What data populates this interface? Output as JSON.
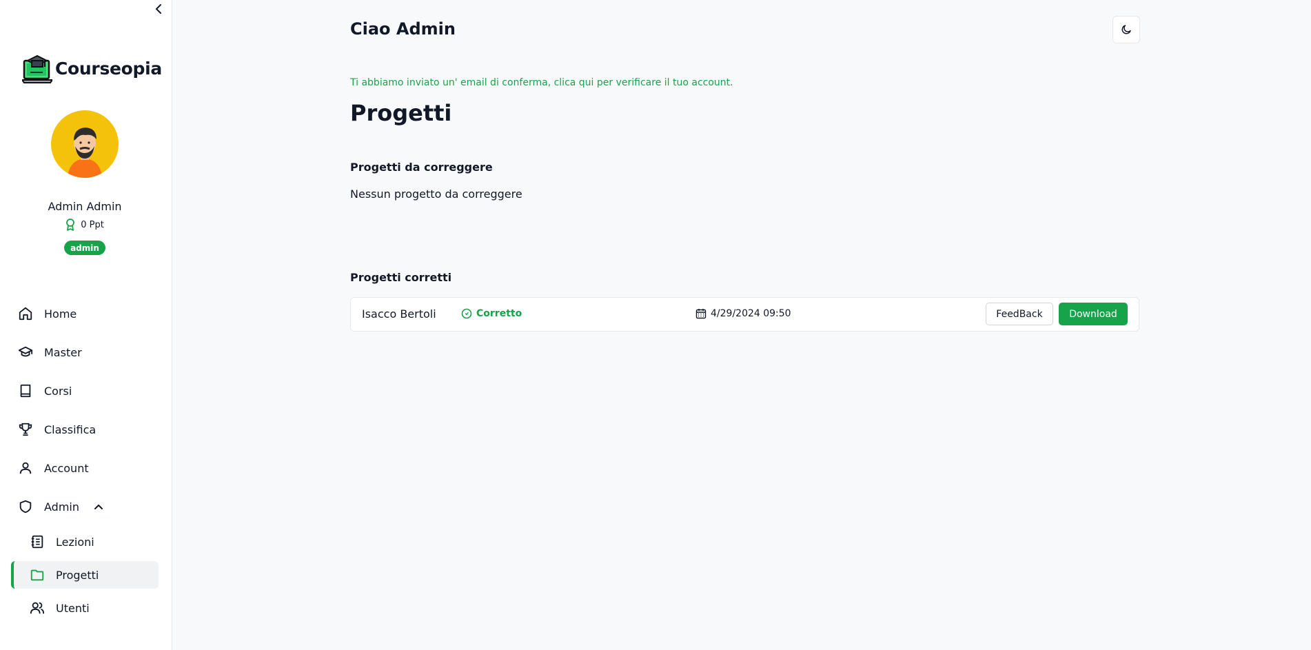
{
  "app": {
    "brand_name": "Courseopia"
  },
  "user": {
    "name": "Admin Admin",
    "points": "0 Ppt",
    "role": "admin"
  },
  "nav": {
    "home": "Home",
    "master": "Master",
    "corsi": "Corsi",
    "classifica": "Classifica",
    "account": "Account",
    "admin": "Admin",
    "sub": {
      "lezioni": "Lezioni",
      "progetti": "Progetti",
      "utenti": "Utenti"
    },
    "active_item": "Progetti"
  },
  "header": {
    "greeting": "Ciao Admin"
  },
  "notice": {
    "verify_email": "Ti abbiamo inviato un' email di conferma, clica qui per verificare il tuo account."
  },
  "page": {
    "title": "Progetti",
    "to_correct": {
      "title": "Progetti da correggere",
      "empty": "Nessun progetto da correggere"
    },
    "corrected": {
      "title": "Progetti corretti",
      "rows": [
        {
          "student": "Isacco Bertoli",
          "status": "Corretto",
          "date": "4/29/2024 09:50",
          "feedback_label": "FeedBack",
          "download_label": "Download"
        }
      ]
    }
  },
  "colors": {
    "accent": "#16a34a",
    "avatar_bg": "#f5c20b",
    "background": "#f8f9fb"
  }
}
